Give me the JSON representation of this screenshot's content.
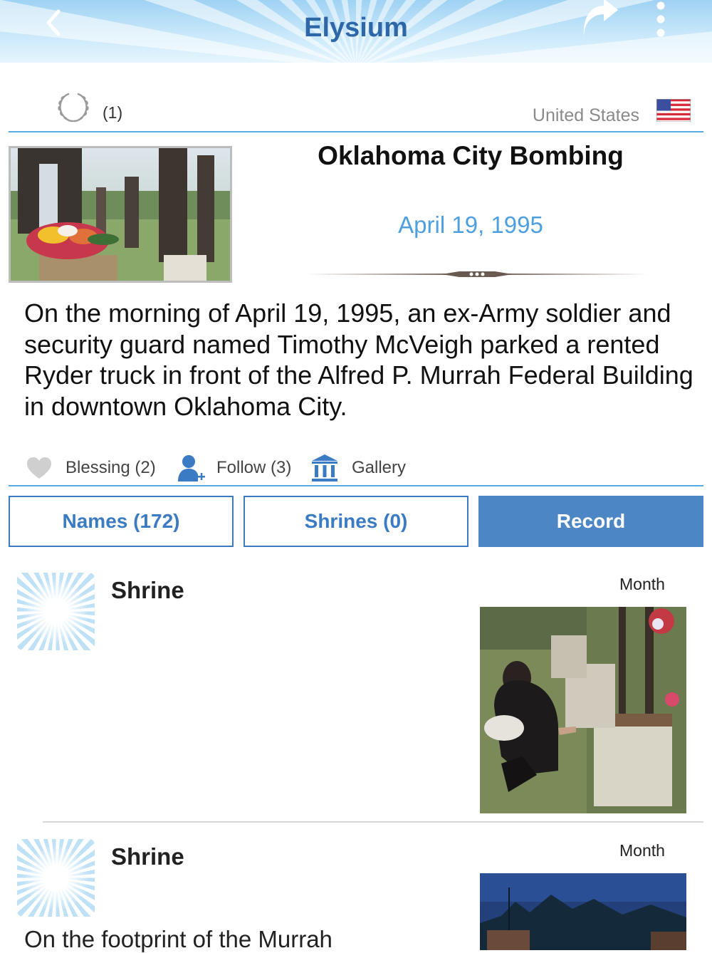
{
  "header": {
    "title": "Elysium",
    "back_icon": "chevron-left-icon",
    "share_icon": "share-arrow-icon",
    "more_icon": "more-vertical-icon"
  },
  "info": {
    "wreath_icon": "laurel-wreath-icon",
    "wreath_count": "(1)",
    "country": "United States",
    "flag_icon": "us-flag-icon"
  },
  "memorial": {
    "title": "Oklahoma City Bombing",
    "date": "April 19, 1995",
    "description": "On the morning of April 19, 1995, an ex-Army soldier and security guard named Timothy McVeigh parked a rented Ryder truck in front of the Alfred P. Murrah Federal Building in downtown Oklahoma City."
  },
  "actions": {
    "blessing": "Blessing (2)",
    "follow": "Follow (3)",
    "gallery": "Gallery"
  },
  "tabs": {
    "names": "Names (172)",
    "shrines": "Shrines (0)",
    "record": "Record"
  },
  "feed": [
    {
      "title": "Shrine",
      "period": "Month"
    },
    {
      "title": "Shrine",
      "period": "Month",
      "text": "On the footprint of the Murrah"
    }
  ],
  "colors": {
    "accent": "#3a7bc4",
    "accent_fill": "#4d86c4",
    "date_blue": "#4d9fe0",
    "rule_blue": "#58a8e2",
    "header_sky": "#9fd2f3"
  }
}
